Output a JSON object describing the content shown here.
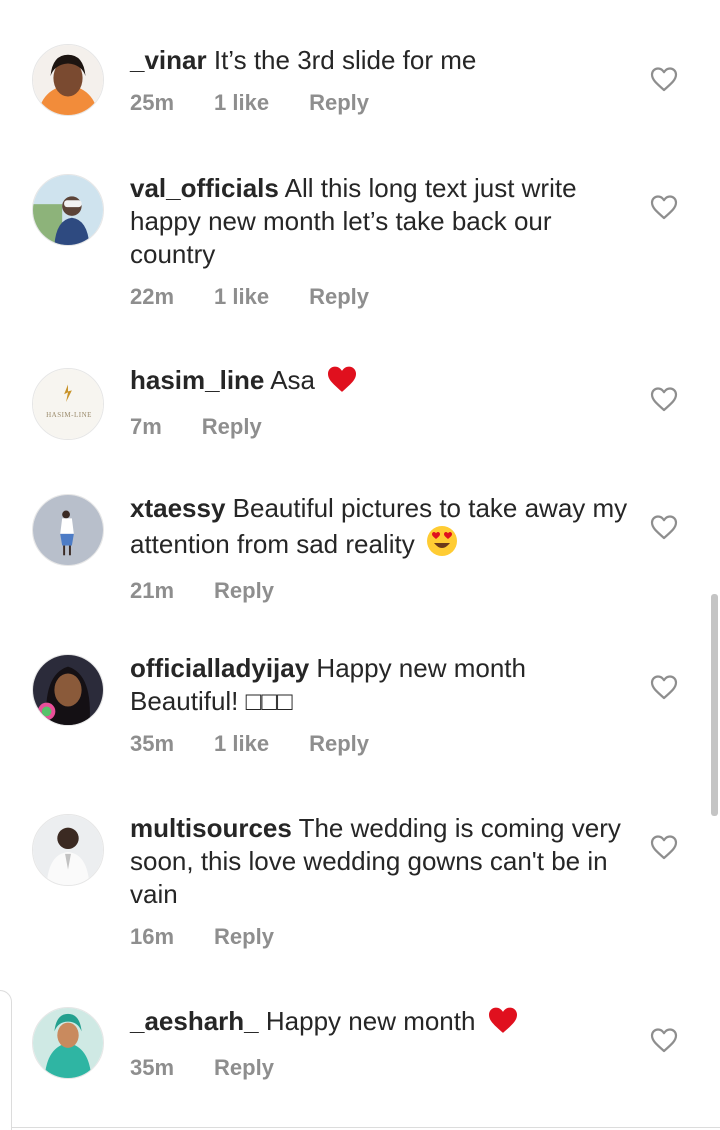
{
  "comments": [
    {
      "username": "_vinar",
      "text": "It’s the 3rd slide for me",
      "time": "25m",
      "likes": "1 like",
      "reply": "Reply",
      "emoji": "",
      "avatar_color": "#f28c3a"
    },
    {
      "username": "val_officials",
      "text": "All this long text  just write happy new month let’s take back our country",
      "time": "22m",
      "likes": "1 like",
      "reply": "Reply",
      "emoji": "",
      "avatar_color": "#9fc4dc"
    },
    {
      "username": "hasim_line",
      "text": "Asa",
      "time": "7m",
      "likes": "",
      "reply": "Reply",
      "emoji": "red-heart",
      "avatar_color": "#f7f5f0",
      "avatar_text": "HASIM-LINE"
    },
    {
      "username": "xtaessy",
      "text": "Beautiful pictures to take away my attention from sad reality",
      "time": "21m",
      "likes": "",
      "reply": "Reply",
      "emoji": "heart-eyes",
      "avatar_color": "#b8bfcb"
    },
    {
      "username": "officialladyijay",
      "text": "Happy new month Beautiful! □□□",
      "time": "35m",
      "likes": "1 like",
      "reply": "Reply",
      "emoji": "",
      "avatar_color": "#2b2b3a"
    },
    {
      "username": "multisources",
      "text": "The wedding is coming very soon, this love wedding gowns can't be in vain",
      "time": "16m",
      "likes": "",
      "reply": "Reply",
      "emoji": "",
      "avatar_color": "#e9eaec"
    },
    {
      "username": "_aesharh_",
      "text": "Happy new month",
      "time": "35m",
      "likes": "",
      "reply": "Reply",
      "emoji": "red-heart",
      "avatar_color": "#2fb5a3"
    }
  ],
  "colors": {
    "text": "#262626",
    "meta": "#8e8e8e",
    "heart_outline": "#8e8e8e",
    "emoji_heart": "#e0101e"
  },
  "icons": {
    "like": "heart-outline-icon"
  }
}
